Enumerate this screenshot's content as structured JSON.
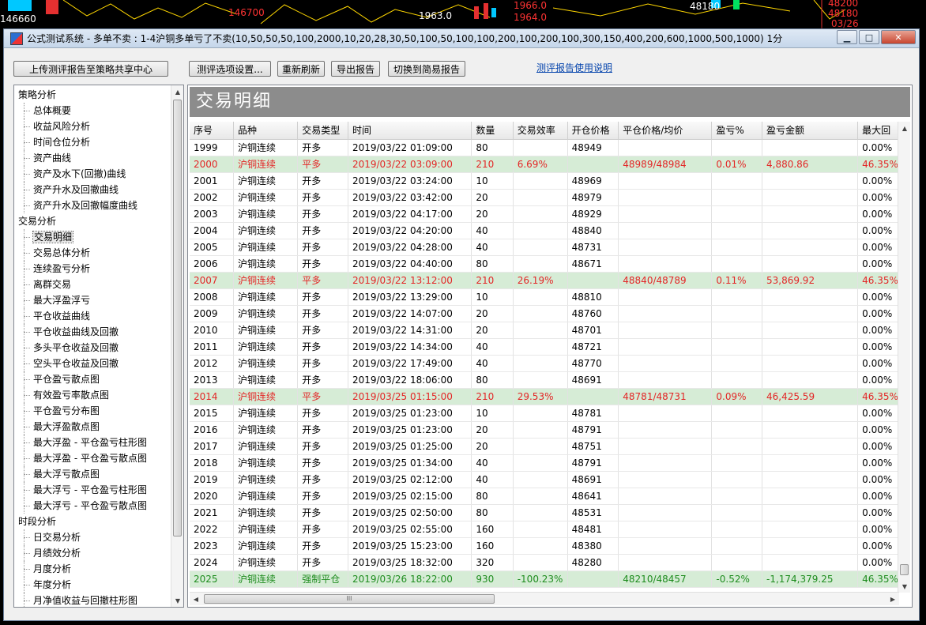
{
  "background": {
    "labels": [
      {
        "text": "146660",
        "color": "#ffffff"
      },
      {
        "text": "146700",
        "color": "#ff3333"
      },
      {
        "text": "1963.0",
        "color": "#ffffff"
      },
      {
        "text": "1966.0",
        "color": "#ff3333"
      },
      {
        "text": "1964.0",
        "color": "#ff3333"
      },
      {
        "text": "48180",
        "color": "#ffffff"
      },
      {
        "text": "48200",
        "color": "#ff3333"
      },
      {
        "text": "48180",
        "color": "#ff3333"
      },
      {
        "text": "03/26",
        "color": "#ff3333"
      }
    ]
  },
  "window": {
    "title": "公式测试系统 - 多单不卖 : 1-4沪铜多单亏了不卖(10,50,50,50,100,2000,10,20,28,30,50,100,50,100,100,200,100,200,100,300,150,400,200,600,1000,500,1000) 1分",
    "minimize": "▁",
    "maximize": "□",
    "close": "✕"
  },
  "toolbar": {
    "upload": "上传测评报告至策略共享中心",
    "options": "测评选项设置...",
    "refresh": "重新刷新",
    "export": "导出报告",
    "switch": "切换到简易报告",
    "help_link": "测评报告使用说明"
  },
  "sidebar": {
    "items": [
      {
        "label": "策略分析",
        "level": 0
      },
      {
        "label": "总体概要",
        "level": 1
      },
      {
        "label": "收益风险分析",
        "level": 1
      },
      {
        "label": "时间仓位分析",
        "level": 1
      },
      {
        "label": "资产曲线",
        "level": 1
      },
      {
        "label": "资产及水下(回撤)曲线",
        "level": 1
      },
      {
        "label": "资产升水及回撤曲线",
        "level": 1
      },
      {
        "label": "资产升水及回撤幅度曲线",
        "level": 1
      },
      {
        "label": "交易分析",
        "level": 0
      },
      {
        "label": "交易明细",
        "level": 1,
        "selected": true
      },
      {
        "label": "交易总体分析",
        "level": 1
      },
      {
        "label": "连续盈亏分析",
        "level": 1
      },
      {
        "label": "离群交易",
        "level": 1
      },
      {
        "label": "最大浮盈浮亏",
        "level": 1
      },
      {
        "label": "平仓收益曲线",
        "level": 1
      },
      {
        "label": "平仓收益曲线及回撤",
        "level": 1
      },
      {
        "label": "多头平仓收益及回撤",
        "level": 1
      },
      {
        "label": "空头平仓收益及回撤",
        "level": 1
      },
      {
        "label": "平仓盈亏散点图",
        "level": 1
      },
      {
        "label": "有效盈亏率散点图",
        "level": 1
      },
      {
        "label": "平仓盈亏分布图",
        "level": 1
      },
      {
        "label": "最大浮盈散点图",
        "level": 1
      },
      {
        "label": "最大浮盈 - 平仓盈亏柱形图",
        "level": 1
      },
      {
        "label": "最大浮盈 - 平仓盈亏散点图",
        "level": 1
      },
      {
        "label": "最大浮亏散点图",
        "level": 1
      },
      {
        "label": "最大浮亏 - 平仓盈亏柱形图",
        "level": 1
      },
      {
        "label": "最大浮亏 - 平仓盈亏散点图",
        "level": 1
      },
      {
        "label": "时段分析",
        "level": 0
      },
      {
        "label": "日交易分析",
        "level": 1
      },
      {
        "label": "月绩效分析",
        "level": 1
      },
      {
        "label": "月度分析",
        "level": 1
      },
      {
        "label": "年度分析",
        "level": 1
      },
      {
        "label": "月净值收益与回撤柱形图",
        "level": 1
      }
    ]
  },
  "main": {
    "title": "交易明细",
    "columns": [
      "序号",
      "品种",
      "交易类型",
      "时间",
      "数量",
      "交易效率",
      "开仓价格",
      "平仓价格/均价",
      "盈亏%",
      "盈亏金额",
      "最大回"
    ],
    "rows": [
      {
        "kind": "open",
        "cells": [
          "1999",
          "沪铜连续",
          "开多",
          "2019/03/22 01:09:00",
          "80",
          "",
          "48949",
          "",
          "",
          "",
          "0.00%"
        ]
      },
      {
        "kind": "close",
        "cells": [
          "2000",
          "沪铜连续",
          "平多",
          "2019/03/22 03:09:00",
          "210",
          "6.69%",
          "",
          "48989/48984",
          "0.01%",
          "4,880.86",
          "46.35%"
        ]
      },
      {
        "kind": "open",
        "cells": [
          "2001",
          "沪铜连续",
          "开多",
          "2019/03/22 03:24:00",
          "10",
          "",
          "48969",
          "",
          "",
          "",
          "0.00%"
        ]
      },
      {
        "kind": "open",
        "cells": [
          "2002",
          "沪铜连续",
          "开多",
          "2019/03/22 03:42:00",
          "20",
          "",
          "48979",
          "",
          "",
          "",
          "0.00%"
        ]
      },
      {
        "kind": "open",
        "cells": [
          "2003",
          "沪铜连续",
          "开多",
          "2019/03/22 04:17:00",
          "20",
          "",
          "48929",
          "",
          "",
          "",
          "0.00%"
        ]
      },
      {
        "kind": "open",
        "cells": [
          "2004",
          "沪铜连续",
          "开多",
          "2019/03/22 04:20:00",
          "40",
          "",
          "48840",
          "",
          "",
          "",
          "0.00%"
        ]
      },
      {
        "kind": "open",
        "cells": [
          "2005",
          "沪铜连续",
          "开多",
          "2019/03/22 04:28:00",
          "40",
          "",
          "48731",
          "",
          "",
          "",
          "0.00%"
        ]
      },
      {
        "kind": "open",
        "cells": [
          "2006",
          "沪铜连续",
          "开多",
          "2019/03/22 04:40:00",
          "80",
          "",
          "48671",
          "",
          "",
          "",
          "0.00%"
        ]
      },
      {
        "kind": "close",
        "cells": [
          "2007",
          "沪铜连续",
          "平多",
          "2019/03/22 13:12:00",
          "210",
          "26.19%",
          "",
          "48840/48789",
          "0.11%",
          "53,869.92",
          "46.35%"
        ]
      },
      {
        "kind": "open",
        "cells": [
          "2008",
          "沪铜连续",
          "开多",
          "2019/03/22 13:29:00",
          "10",
          "",
          "48810",
          "",
          "",
          "",
          "0.00%"
        ]
      },
      {
        "kind": "open",
        "cells": [
          "2009",
          "沪铜连续",
          "开多",
          "2019/03/22 14:07:00",
          "20",
          "",
          "48760",
          "",
          "",
          "",
          "0.00%"
        ]
      },
      {
        "kind": "open",
        "cells": [
          "2010",
          "沪铜连续",
          "开多",
          "2019/03/22 14:31:00",
          "20",
          "",
          "48701",
          "",
          "",
          "",
          "0.00%"
        ]
      },
      {
        "kind": "open",
        "cells": [
          "2011",
          "沪铜连续",
          "开多",
          "2019/03/22 14:34:00",
          "40",
          "",
          "48721",
          "",
          "",
          "",
          "0.00%"
        ]
      },
      {
        "kind": "open",
        "cells": [
          "2012",
          "沪铜连续",
          "开多",
          "2019/03/22 17:49:00",
          "40",
          "",
          "48770",
          "",
          "",
          "",
          "0.00%"
        ]
      },
      {
        "kind": "open",
        "cells": [
          "2013",
          "沪铜连续",
          "开多",
          "2019/03/22 18:06:00",
          "80",
          "",
          "48691",
          "",
          "",
          "",
          "0.00%"
        ]
      },
      {
        "kind": "close",
        "cells": [
          "2014",
          "沪铜连续",
          "平多",
          "2019/03/25 01:15:00",
          "210",
          "29.53%",
          "",
          "48781/48731",
          "0.09%",
          "46,425.59",
          "46.35%"
        ]
      },
      {
        "kind": "open",
        "cells": [
          "2015",
          "沪铜连续",
          "开多",
          "2019/03/25 01:23:00",
          "10",
          "",
          "48781",
          "",
          "",
          "",
          "0.00%"
        ]
      },
      {
        "kind": "open",
        "cells": [
          "2016",
          "沪铜连续",
          "开多",
          "2019/03/25 01:23:00",
          "20",
          "",
          "48791",
          "",
          "",
          "",
          "0.00%"
        ]
      },
      {
        "kind": "open",
        "cells": [
          "2017",
          "沪铜连续",
          "开多",
          "2019/03/25 01:25:00",
          "20",
          "",
          "48751",
          "",
          "",
          "",
          "0.00%"
        ]
      },
      {
        "kind": "open",
        "cells": [
          "2018",
          "沪铜连续",
          "开多",
          "2019/03/25 01:34:00",
          "40",
          "",
          "48791",
          "",
          "",
          "",
          "0.00%"
        ]
      },
      {
        "kind": "open",
        "cells": [
          "2019",
          "沪铜连续",
          "开多",
          "2019/03/25 02:12:00",
          "40",
          "",
          "48691",
          "",
          "",
          "",
          "0.00%"
        ]
      },
      {
        "kind": "open",
        "cells": [
          "2020",
          "沪铜连续",
          "开多",
          "2019/03/25 02:15:00",
          "80",
          "",
          "48641",
          "",
          "",
          "",
          "0.00%"
        ]
      },
      {
        "kind": "open",
        "cells": [
          "2021",
          "沪铜连续",
          "开多",
          "2019/03/25 02:50:00",
          "80",
          "",
          "48531",
          "",
          "",
          "",
          "0.00%"
        ]
      },
      {
        "kind": "open",
        "cells": [
          "2022",
          "沪铜连续",
          "开多",
          "2019/03/25 02:55:00",
          "160",
          "",
          "48481",
          "",
          "",
          "",
          "0.00%"
        ]
      },
      {
        "kind": "open",
        "cells": [
          "2023",
          "沪铜连续",
          "开多",
          "2019/03/25 15:23:00",
          "160",
          "",
          "48380",
          "",
          "",
          "",
          "0.00%"
        ]
      },
      {
        "kind": "open",
        "cells": [
          "2024",
          "沪铜连续",
          "开多",
          "2019/03/25 18:32:00",
          "320",
          "",
          "48280",
          "",
          "",
          "",
          "0.00%"
        ]
      },
      {
        "kind": "forced",
        "cells": [
          "2025",
          "沪铜连续",
          "强制平仓",
          "2019/03/26 18:22:00",
          "930",
          "-100.23%",
          "",
          "48210/48457",
          "-0.52%",
          "-1,174,379.25",
          "46.35%"
        ]
      }
    ],
    "scroll_grip": "lll",
    "colors": {
      "close_row_bg": "#d6ecd6",
      "close_text": "#e32626",
      "forced_text": "#1e8c1e"
    }
  }
}
